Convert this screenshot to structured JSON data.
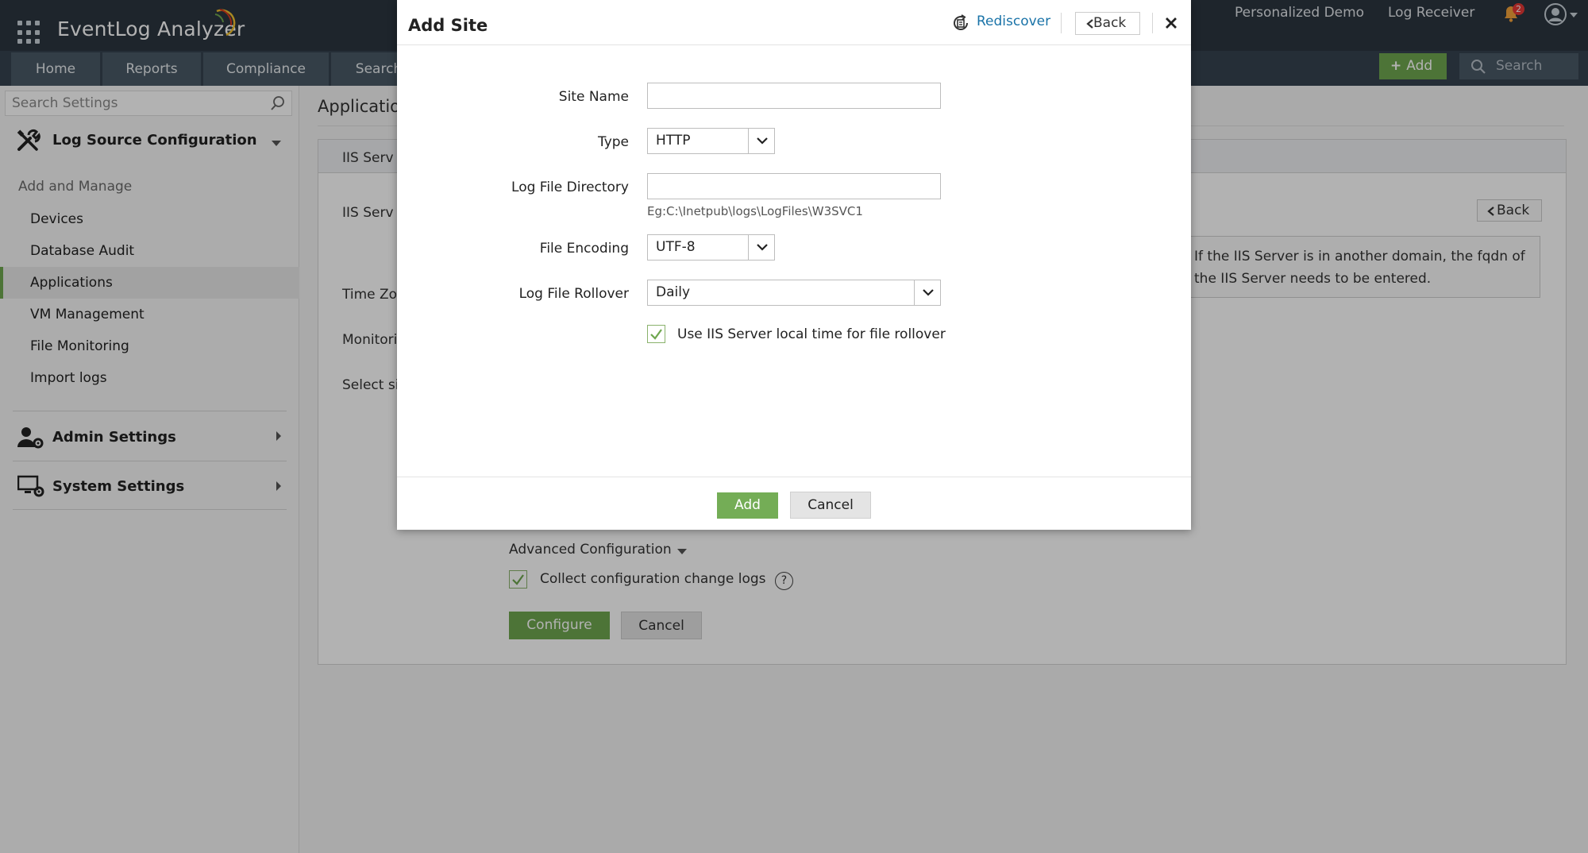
{
  "app": {
    "name": "EventLog Analyzer",
    "top_links": [
      "Personalized Demo",
      "Log Receiver"
    ],
    "notification_count": "2"
  },
  "nav": {
    "tabs": [
      "Home",
      "Reports",
      "Compliance",
      "Search"
    ],
    "add_label": "Add",
    "search_placeholder": "Search"
  },
  "sidebar": {
    "search_placeholder": "Search Settings",
    "section_title": "Log Source Configuration",
    "subheading": "Add and Manage",
    "items": [
      "Devices",
      "Database Audit",
      "Applications",
      "VM Management",
      "File Monitoring",
      "Import logs"
    ],
    "active_item": "Applications",
    "admin_settings": "Admin Settings",
    "system_settings": "System Settings"
  },
  "background": {
    "page_title": "Application",
    "tab_label": "IIS Serv",
    "labels": [
      "IIS Serv",
      "Time Zo",
      "Monitori",
      "Select si"
    ],
    "back_label": "Back",
    "info_text": "If the IIS Server is in another domain, the fqdn of the IIS Server needs to be entered.",
    "advanced_config": "Advanced Configuration",
    "collect_config_label": "Collect configuration change logs",
    "collect_config_checked": true,
    "configure_label": "Configure",
    "cancel_label": "Cancel"
  },
  "modal": {
    "title": "Add Site",
    "rediscover_label": "Rediscover",
    "back_label": "Back",
    "fields": {
      "site_name": {
        "label": "Site Name",
        "value": ""
      },
      "type": {
        "label": "Type",
        "value": "HTTP"
      },
      "log_file_directory": {
        "label": "Log File Directory",
        "value": "",
        "hint": "Eg:C:\\Inetpub\\logs\\LogFiles\\W3SVC1"
      },
      "file_encoding": {
        "label": "File Encoding",
        "value": "UTF-8"
      },
      "log_file_rollover": {
        "label": "Log File Rollover",
        "value": "Daily"
      }
    },
    "local_time_label": "Use IIS Server local time for file rollover",
    "local_time_checked": true,
    "add_label": "Add",
    "cancel_label": "Cancel"
  },
  "colors": {
    "accent_green": "#6fa74f",
    "header_bg": "#2b3540",
    "nav_bg": "#36434f",
    "link_blue": "#1a73a8"
  }
}
